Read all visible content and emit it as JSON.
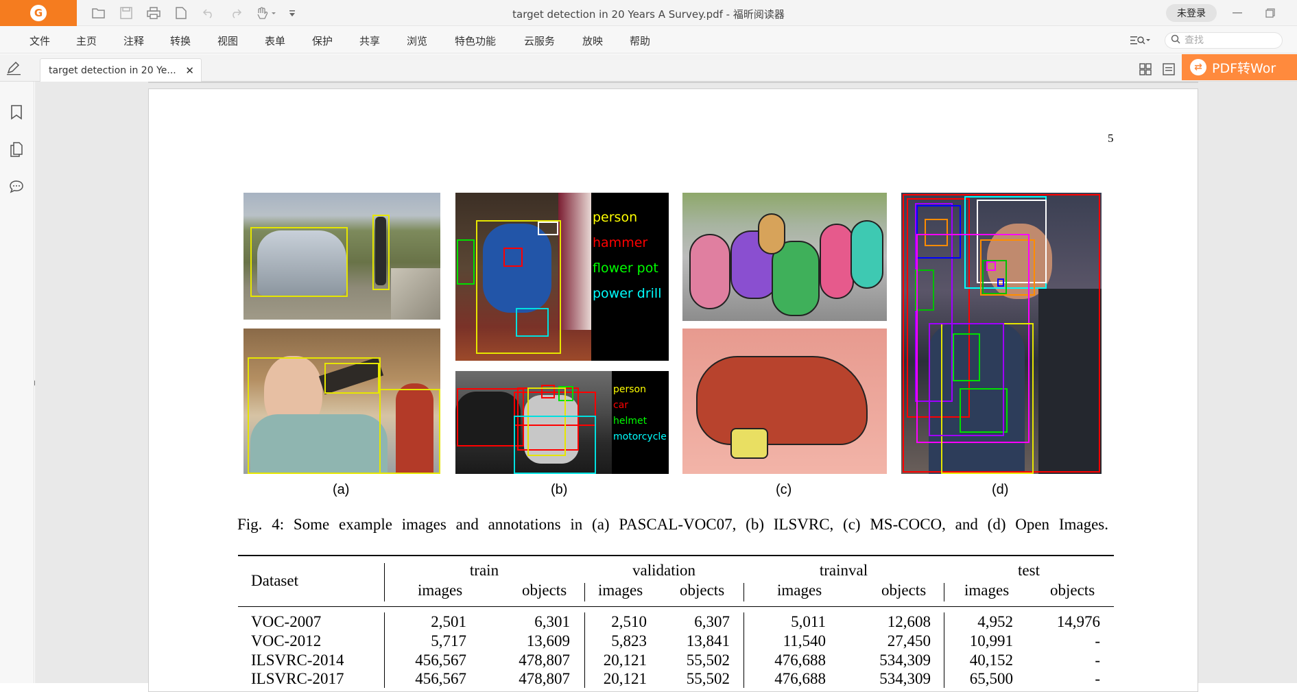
{
  "app": {
    "title": "target detection in 20 Years A Survey.pdf - 福昕阅读器",
    "login_label": "未登录",
    "pdf_to_word_label": "PDF转Wor"
  },
  "menu": [
    "文件",
    "主页",
    "注释",
    "转换",
    "视图",
    "表单",
    "保护",
    "共享",
    "浏览",
    "特色功能",
    "云服务",
    "放映",
    "帮助"
  ],
  "search": {
    "placeholder": "查找"
  },
  "tab": {
    "label": "target detection in 20 Ye..."
  },
  "page": {
    "page_number": "5",
    "figure_labels": [
      "(a)",
      "(b)",
      "(c)",
      "(d)"
    ],
    "legend_b1": [
      "person",
      "hammer",
      "flower pot",
      "power drill"
    ],
    "legend_b2": [
      "person",
      "car",
      "helmet",
      "motorcycle"
    ],
    "caption": "Fig. 4: Some example images and annotations in (a) PASCAL-VOC07, (b) ILSVRC, (c) MS-COCO, and (d) Open Images."
  },
  "table": {
    "dataset_header": "Dataset",
    "groups": [
      "train",
      "validation",
      "trainval",
      "test"
    ],
    "subheaders": [
      "images",
      "objects"
    ],
    "rows": [
      [
        "VOC-2007",
        "2,501",
        "6,301",
        "2,510",
        "6,307",
        "5,011",
        "12,608",
        "4,952",
        "14,976"
      ],
      [
        "VOC-2012",
        "5,717",
        "13,609",
        "5,823",
        "13,841",
        "11,540",
        "27,450",
        "10,991",
        "-"
      ],
      [
        "ILSVRC-2014",
        "456,567",
        "478,807",
        "20,121",
        "55,502",
        "476,688",
        "534,309",
        "40,152",
        "-"
      ],
      [
        "ILSVRC-2017",
        "456,567",
        "478,807",
        "20,121",
        "55,502",
        "476,688",
        "534,309",
        "65,500",
        "-"
      ]
    ]
  },
  "colors": {
    "brand": "#f57c1f",
    "pdf_to_word_bg": "#ff8a3d",
    "legend_person": "#ffff00",
    "legend_hammer": "#ff0000",
    "legend_flower_pot": "#00ff00",
    "legend_power_drill": "#00ffff"
  }
}
